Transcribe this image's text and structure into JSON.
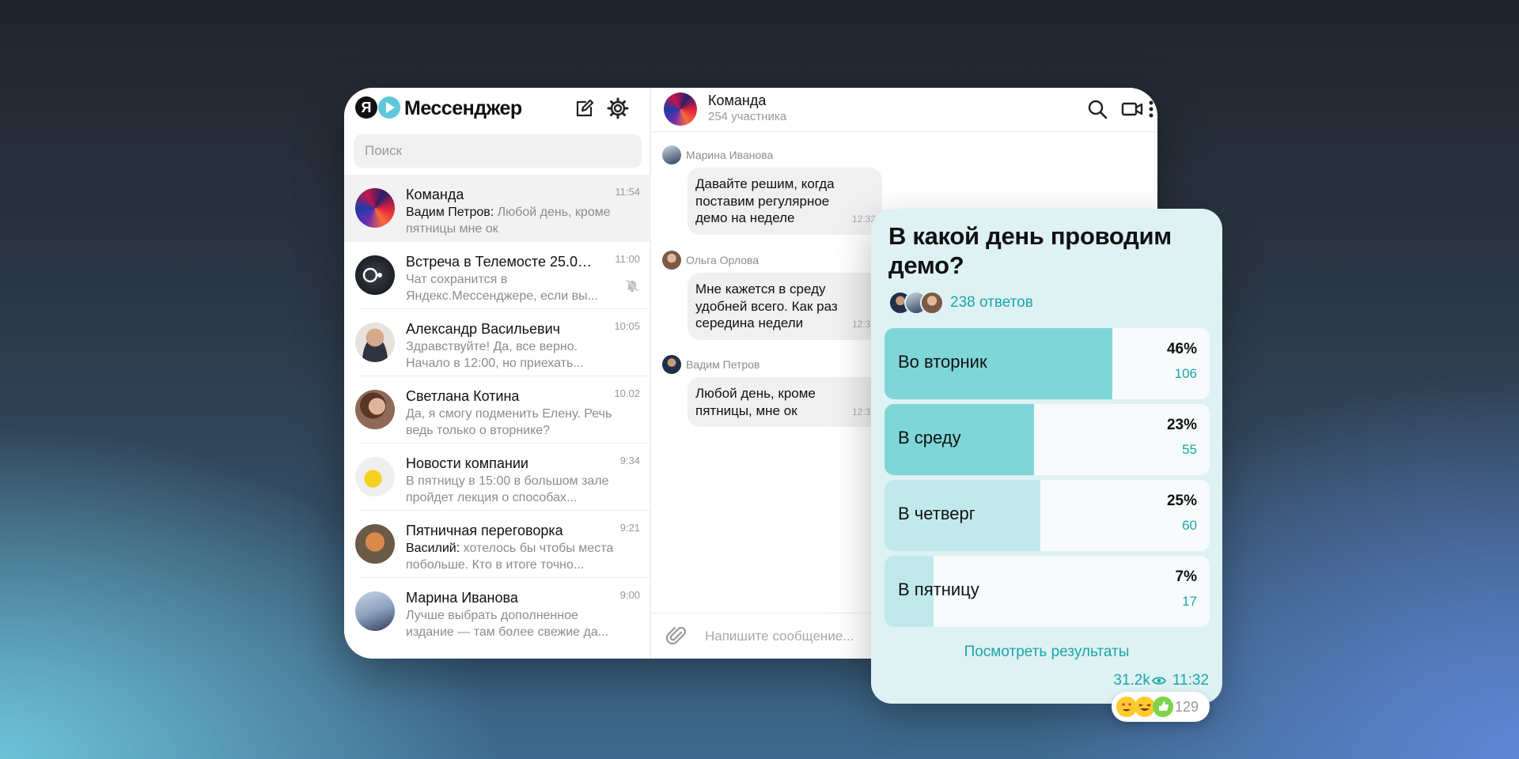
{
  "app": {
    "title": "Мессенджер",
    "logo_letter": "Я",
    "search_placeholder": "Поиск"
  },
  "chats": [
    {
      "name": "Команда",
      "author": "Вадим Петров:",
      "preview": " Любой день, кроме пятницы мне ок",
      "time": "11:54",
      "active": true
    },
    {
      "name": "Встреча в Телемосте 25.05 ...",
      "author": "",
      "preview": "Чат сохранится в Яндекс.Мессенджере, если вы...",
      "time": "11:00",
      "muted": true
    },
    {
      "name": "Александр Васильевич",
      "author": "",
      "preview": "Здравствуйте! Да, все верно. Начало в 12:00, но приехать...",
      "time": "10:05"
    },
    {
      "name": "Светлана Котина",
      "author": "",
      "preview": "Да, я смогу подменить Елену. Речь ведь только о вторнике?",
      "time": "10.02"
    },
    {
      "name": "Новости компании",
      "author": "",
      "preview": "В пятницу в 15:00 в большом зале пройдет лекция о способах...",
      "time": "9:34"
    },
    {
      "name": "Пятничная переговорка",
      "author": "Василий:",
      "preview": " хотелось бы чтобы места побольше. Кто в итоге точно...",
      "time": "9:21"
    },
    {
      "name": "Марина Иванова",
      "author": "",
      "preview": "Лучше выбрать дополненное издание — там более свежие да...",
      "time": "9:00"
    }
  ],
  "conversation": {
    "title": "Команда",
    "subtitle": "254 участника",
    "messages": [
      {
        "author": "Марина Иванова",
        "text": "Давайте решим, когда поставим регулярное демо на неделе",
        "time": "12:32"
      },
      {
        "author": "Ольга Орлова",
        "text": "Мне кажется в среду удобней всего. Как раз середина недели",
        "time": "12:33"
      },
      {
        "author": "Вадим Петров",
        "text": "Любой день, кроме пятницы, мне ок",
        "time": "12:35"
      }
    ],
    "composer_placeholder": "Напишите сообщение..."
  },
  "poll": {
    "question": "В какой день проводим демо?",
    "answers_count": "238 ответов",
    "options": [
      {
        "label": "Во вторник",
        "percent": "46%",
        "votes": "106",
        "fraction": 0.7,
        "color": "#7fd6d8"
      },
      {
        "label": "В среду",
        "percent": "23%",
        "votes": "55",
        "fraction": 0.46,
        "color": "#7fd6d8"
      },
      {
        "label": "В четверг",
        "percent": "25%",
        "votes": "60",
        "fraction": 0.48,
        "color": "#c1e9eb"
      },
      {
        "label": "В пятницу",
        "percent": "7%",
        "votes": "17",
        "fraction": 0.15,
        "color": "#c1e9eb"
      }
    ],
    "results_link": "Посмотреть результаты",
    "views": "31.2k",
    "time": "11:32",
    "reactions_count": "129"
  },
  "icons": {
    "compose": "compose-icon",
    "settings": "gear-icon",
    "search": "search-icon",
    "video": "video-icon",
    "menu": "more-vertical-icon",
    "attach": "paperclip-icon",
    "mute": "bell-off-icon",
    "views": "eye-icon"
  },
  "colors": {
    "accent": "#1aa6a8",
    "poll_bg": "#def1f3"
  }
}
